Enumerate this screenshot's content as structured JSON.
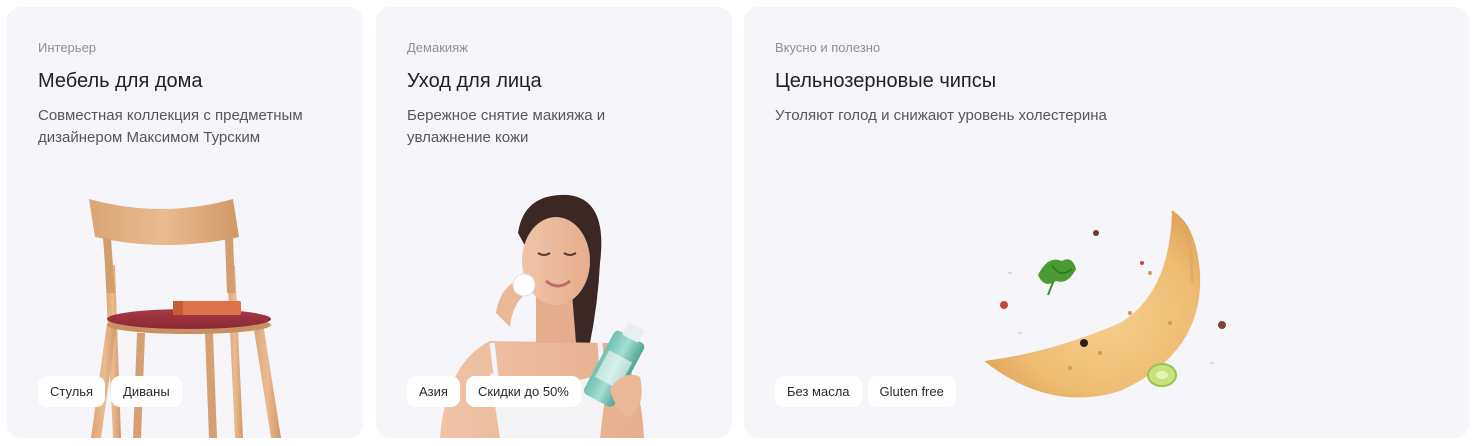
{
  "cards": [
    {
      "eyebrow": "Интерьер",
      "title": "Мебель для дома",
      "description": "Совместная коллекция с предметным дизайнером Максимом Турским",
      "tags": [
        "Стулья",
        "Диваны"
      ]
    },
    {
      "eyebrow": "Демакияж",
      "title": "Уход для лица",
      "description": "Бережное снятие макияжа и увлажнение кожи",
      "tags": [
        "Азия",
        "Скидки до 50%"
      ]
    },
    {
      "eyebrow": "Вкусно и полезно",
      "title": "Цельнозерновые чипсы",
      "description": "Утоляют голод и снижают уровень холестерина",
      "tags": [
        "Без масла",
        "Gluten free"
      ]
    }
  ],
  "colors": {
    "card_background": "#f6f5fa",
    "tag_background": "#ffffff",
    "eyebrow_text": "#8f8f97",
    "title_text": "#1f1f24",
    "description_text": "#55555d"
  },
  "icons": {
    "card_1_image": "wooden-chair-image",
    "card_2_image": "woman-skincare-image",
    "card_3_image": "chip-image"
  }
}
